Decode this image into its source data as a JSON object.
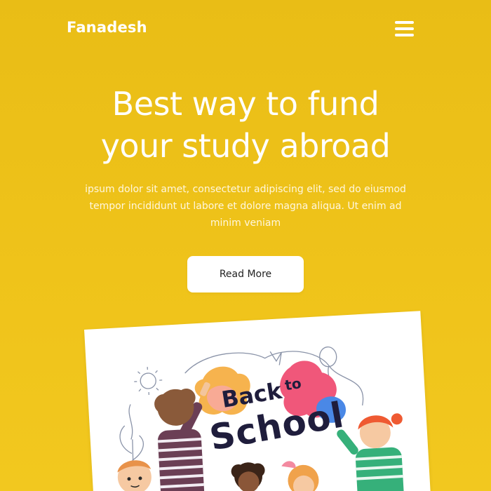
{
  "brand": {
    "name": "Fanadesh"
  },
  "nav": {
    "menu_icon": "hamburger-menu-icon"
  },
  "hero": {
    "title_line1": "Best way to fund",
    "title_line2": "your study abroad",
    "text_line1": "ipsum dolor sit amet, consectetur adipiscing elit, sed do eiusmod",
    "text_line2": "tempor incididunt ut labore et dolore magna aliqua. Ut enim ad",
    "text_line3": "minim veniam",
    "cta_label": "Read More"
  },
  "illustration": {
    "title_word1": "Back",
    "title_word2": "to",
    "title_word3": "School"
  },
  "colors": {
    "background": "#ecc11a",
    "text": "#ffffff",
    "button_bg": "#ffffff",
    "button_text": "#222222",
    "illustration_title": "#1f1d3c"
  }
}
